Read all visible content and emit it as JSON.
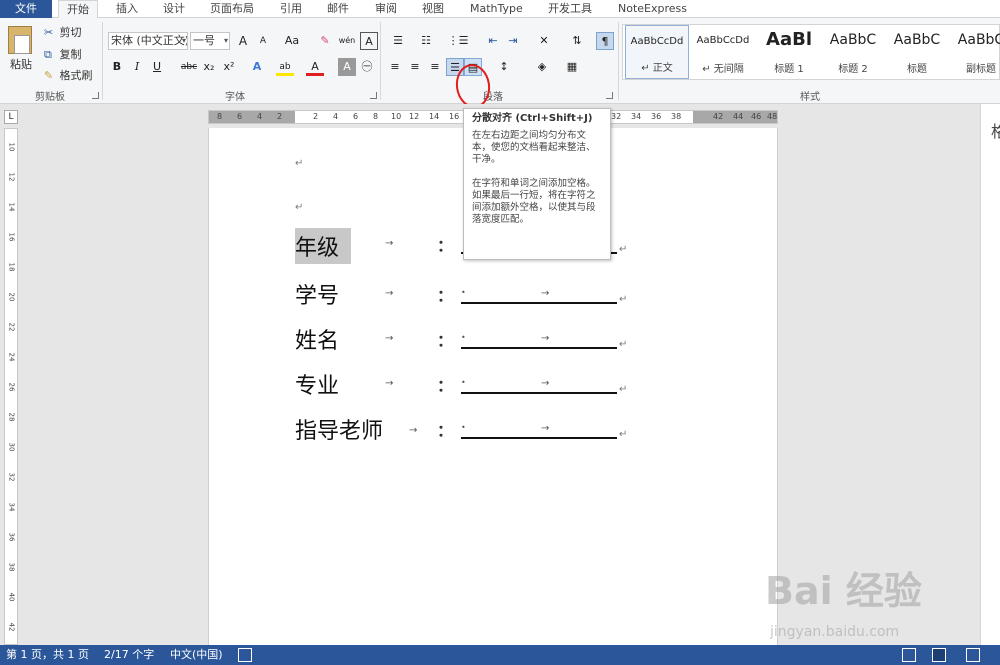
{
  "tabs": {
    "file": "文件",
    "items": [
      "开始",
      "插入",
      "设计",
      "页面布局",
      "引用",
      "邮件",
      "审阅",
      "视图",
      "MathType",
      "开发工具",
      "NoteExpress"
    ],
    "active_index": 0
  },
  "clipboard": {
    "paste": "粘贴",
    "cut": "剪切",
    "copy": "复制",
    "format_painter": "格式刷",
    "group_label": "剪贴板"
  },
  "font": {
    "name": "宋体 (中文正文)",
    "size": "一号",
    "group_label": "字体",
    "buttons": [
      "A",
      "A",
      "Aa",
      "✎",
      "wén",
      "A",
      "B",
      "I",
      "U",
      "abc",
      "x₂",
      "x²",
      "A",
      "ab",
      "A",
      "A",
      "㊀"
    ]
  },
  "paragraph": {
    "group_label": "段落"
  },
  "styles": {
    "group_label": "样式",
    "items": [
      {
        "preview": "AaBbCcDd",
        "name": "↵ 正文"
      },
      {
        "preview": "AaBbCcDd",
        "name": "↵ 无间隔"
      },
      {
        "preview": "AaBl",
        "name": "标题 1"
      },
      {
        "preview": "AaBbC",
        "name": "标题 2"
      },
      {
        "preview": "AaBbC",
        "name": "标题"
      },
      {
        "preview": "AaBbC",
        "name": "副标题"
      }
    ]
  },
  "tooltip": {
    "title": "分散对齐 (Ctrl+Shift+J)",
    "p1": "在左右边距之间均匀分布文本，使您的文档看起来整洁、干净。",
    "p2": "在字符和单词之间添加空格。如果最后一行短，将在字符之间添加额外空格，以使其与段落宽度匹配。"
  },
  "ruler": {
    "corner": "L",
    "h_ticks": [
      "8",
      "6",
      "4",
      "2",
      "",
      "2",
      "4",
      "6",
      "8",
      "10",
      "12",
      "14",
      "16",
      "32",
      "34",
      "36",
      "38",
      "",
      "42",
      "44",
      "46",
      "48"
    ],
    "v_ticks": [
      "10",
      "12",
      "14",
      "16",
      "18",
      "20",
      "22",
      "24",
      "26",
      "28",
      "30",
      "32",
      "34",
      "36",
      "38",
      "40",
      "42"
    ]
  },
  "document": {
    "para_mark": "↵",
    "tab_arrow": "→",
    "colon": "：",
    "dot": "•",
    "rows": [
      {
        "label": "年级"
      },
      {
        "label": "学号"
      },
      {
        "label": "姓名"
      },
      {
        "label": "专业"
      },
      {
        "label": "指导老师"
      }
    ]
  },
  "right_pane": {
    "title": "格"
  },
  "status": {
    "page": "第 1 页，共 1 页",
    "words": "2/17 个字",
    "lang": "中文(中国)"
  },
  "watermark": {
    "main": "Bai 经验",
    "sub": "jingyan.baidu.com"
  },
  "colors": {
    "accent": "#2b579a",
    "annotation": "#e21d1d"
  }
}
